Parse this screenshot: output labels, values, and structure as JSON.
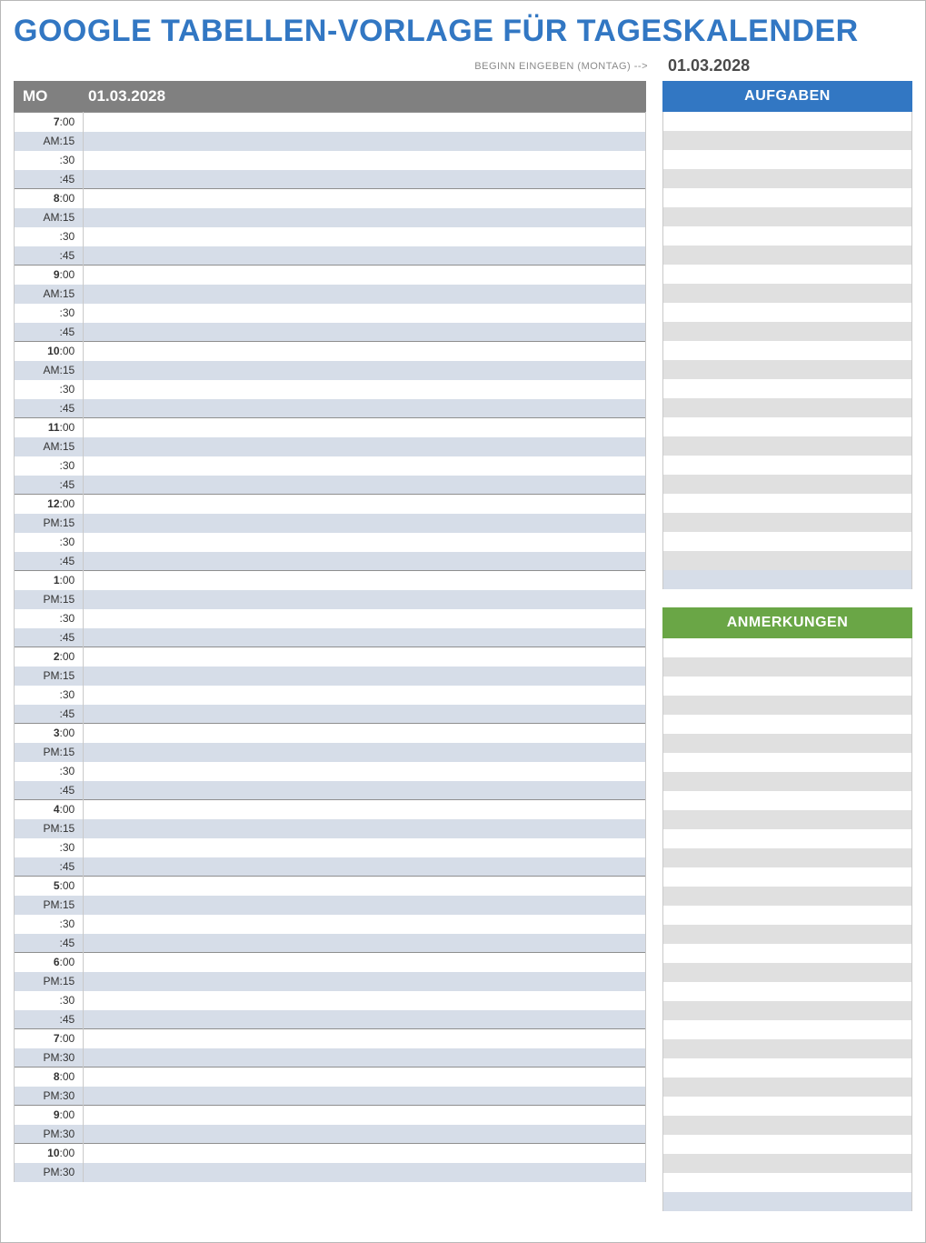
{
  "title": "GOOGLE TABELLEN-VORLAGE FÜR TAGESKALENDER",
  "start_label": "BEGINN EINGEBEN (MONTAG) -->",
  "start_date": "01.03.2028",
  "day": {
    "dow": "MO",
    "date": "01.03.2028"
  },
  "minutes4": [
    ":00",
    ":15",
    ":30",
    ":45"
  ],
  "minutes2": [
    ":00",
    ":30"
  ],
  "hours_quarter": [
    {
      "hour": "7",
      "ampm": "AM"
    },
    {
      "hour": "8",
      "ampm": "AM"
    },
    {
      "hour": "9",
      "ampm": "AM"
    },
    {
      "hour": "10",
      "ampm": "AM"
    },
    {
      "hour": "11",
      "ampm": "AM"
    },
    {
      "hour": "12",
      "ampm": "PM"
    },
    {
      "hour": "1",
      "ampm": "PM"
    },
    {
      "hour": "2",
      "ampm": "PM"
    },
    {
      "hour": "3",
      "ampm": "PM"
    },
    {
      "hour": "4",
      "ampm": "PM"
    },
    {
      "hour": "5",
      "ampm": "PM"
    },
    {
      "hour": "6",
      "ampm": "PM"
    }
  ],
  "hours_half": [
    {
      "hour": "7",
      "ampm": "PM"
    },
    {
      "hour": "8",
      "ampm": "PM"
    },
    {
      "hour": "9",
      "ampm": "PM"
    },
    {
      "hour": "10",
      "ampm": "PM"
    }
  ],
  "tasks_header": "AUFGABEN",
  "notes_header": "ANMERKUNGEN",
  "tasks_rows": 25,
  "notes_rows": 30
}
